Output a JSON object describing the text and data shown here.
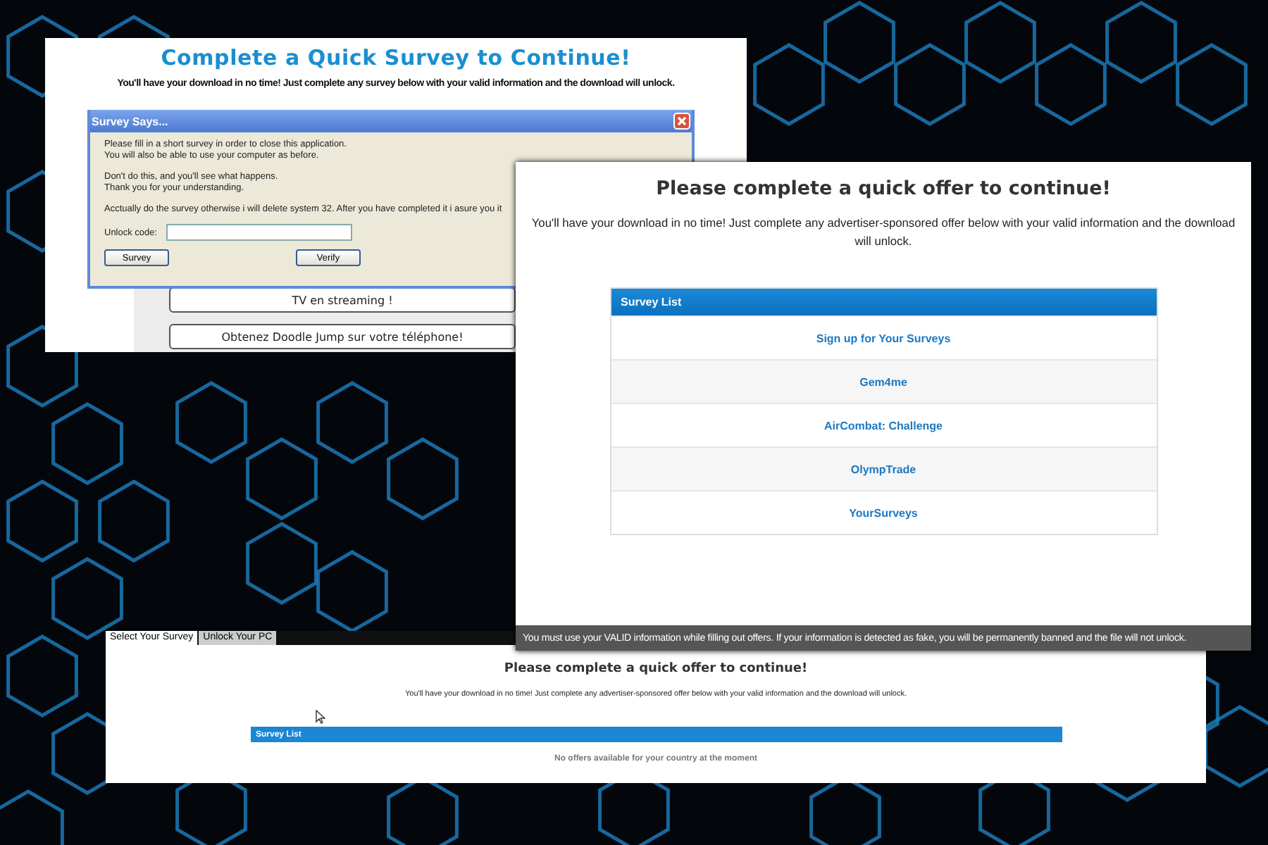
{
  "survey_page": {
    "title": "Complete a Quick Survey to Continue!",
    "intro": "You'll have your download in no time! Just complete any survey below with your valid information and the download will unlock.",
    "dialog": {
      "title": "Survey Says...",
      "paragraphs": [
        [
          "Please fill in a short survey in order to close this application.",
          "You will also be able to use your computer as before."
        ],
        [
          "Don't do this, and you'll see what happens.",
          "Thank you for your understanding."
        ],
        [
          "Acctually do the survey otherwise i will delete system 32. After you have completed it i asure you it"
        ]
      ],
      "unlock_label": "Unlock code:",
      "buttons": [
        "Survey",
        "Verify"
      ]
    },
    "offer_buttons": [
      "TV en streaming !",
      "Obtenez Doodle Jump sur votre téléphone!"
    ]
  },
  "offer_page": {
    "title": "Please complete a quick offer to continue!",
    "intro": "You'll have your download in no time! Just complete any advertiser-sponsored offer below with your valid information and the download will unlock.",
    "list": {
      "header": "Survey List",
      "items": [
        "Sign up for Your Surveys",
        "Gem4me",
        "AirCombat: Challenge",
        "OlympTrade",
        "YourSurveys"
      ]
    },
    "notice": "You must use your VALID information while filling out offers. If your information is detected as fake, you will be permanently banned and the file will not unlock."
  },
  "tabbed_page": {
    "tabs": [
      {
        "label": "Select Your Survey",
        "selected": true
      },
      {
        "label": "Unlock Your PC",
        "selected": false
      }
    ],
    "title": "Please complete a quick offer to continue!",
    "intro": "You'll have your download in no time! Just complete any advertiser-sponsored offer below with your valid information and the download will unlock.",
    "list": {
      "header": "Survey List",
      "empty_message": "No offers available for your country at the moment"
    }
  }
}
